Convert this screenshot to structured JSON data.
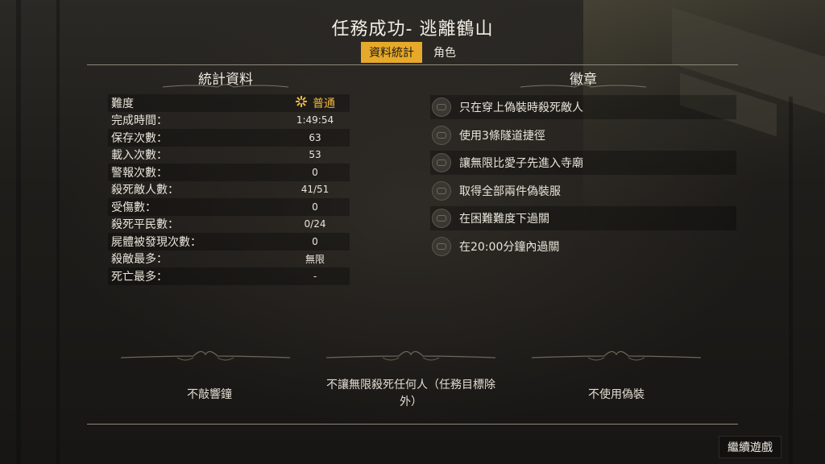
{
  "title": "任務成功- 逃離鶴山",
  "tabs": [
    {
      "label": "資料統計",
      "active": true
    },
    {
      "label": "角色",
      "active": false
    }
  ],
  "stats": {
    "heading": "統計資料",
    "difficulty": {
      "label": "難度",
      "value": "普通"
    },
    "rows": [
      {
        "label": "完成時間：",
        "value": "1:49:54"
      },
      {
        "label": "保存次數：",
        "value": "63"
      },
      {
        "label": "載入次數：",
        "value": "53"
      },
      {
        "label": "警報次數：",
        "value": "0"
      },
      {
        "label": "殺死敵人數：",
        "value": "41/51"
      },
      {
        "label": "受傷數：",
        "value": "0"
      },
      {
        "label": "殺死平民數：",
        "value": "0/24"
      },
      {
        "label": "屍體被發現次數：",
        "value": "0"
      },
      {
        "label": "殺敵最多：",
        "value": "無限"
      },
      {
        "label": "死亡最多：",
        "value": "-"
      }
    ]
  },
  "badges": {
    "heading": "徽章",
    "items": [
      {
        "label": "只在穿上偽裝時殺死敵人"
      },
      {
        "label": "使用3條隧道捷徑"
      },
      {
        "label": "讓無限比愛子先進入寺廟"
      },
      {
        "label": "取得全部兩件偽裝服"
      },
      {
        "label": "在困難難度下過關"
      },
      {
        "label": "在20:00分鐘內過關"
      }
    ]
  },
  "objectives": [
    {
      "label": "不敲響鐘"
    },
    {
      "label": "不讓無限殺死任何人（任務目標除外）"
    },
    {
      "label": "不使用偽裝"
    }
  ],
  "continue_label": "繼續遊戲",
  "colors": {
    "accent": "#e6a92a",
    "difficulty": "#f2b53a"
  }
}
